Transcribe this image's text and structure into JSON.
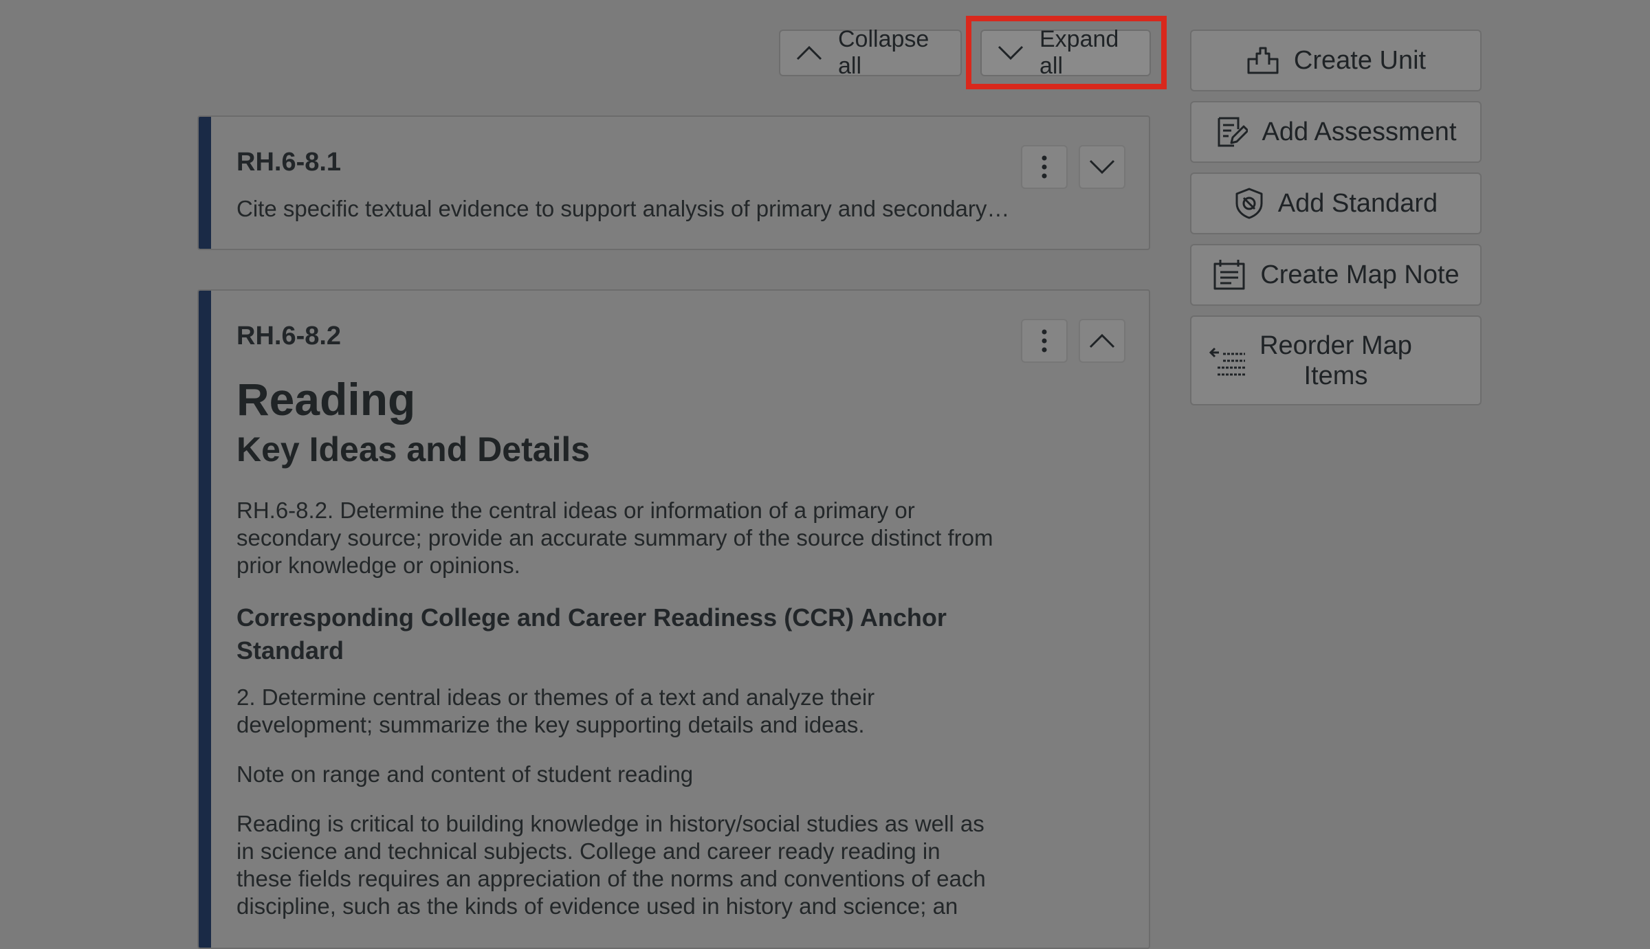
{
  "toolbar": {
    "collapse_all": "Collapse all",
    "expand_all": "Expand all"
  },
  "cards": [
    {
      "code": "RH.6-8.1",
      "summary": "Cite specific textual evidence to support analysis of primary and secondary…",
      "expanded": false
    },
    {
      "code": "RH.6-8.2",
      "expanded": true,
      "heading": "Reading",
      "subheading": "Key Ideas and Details",
      "description": "RH.6-8.2. Determine the central ideas or information of a primary or secondary source; provide an accurate summary of the source distinct from prior knowledge or opinions.",
      "ccr_heading": "Corresponding College and Career Readiness (CCR) Anchor Standard",
      "ccr_text": "2. Determine central ideas or themes of a text and analyze their development; summarize the key supporting details and ideas.",
      "note_title": "Note on range and content of student reading",
      "note_text": "Reading is critical to building knowledge in history/social studies as well as in science and technical subjects. College and career ready reading in these fields requires an appreciation of the norms and conventions of each discipline, such as the kinds of evidence used in history and science; an"
    }
  ],
  "sidebar": {
    "create_unit": "Create Unit",
    "add_assessment": "Add Assessment",
    "add_standard": "Add Standard",
    "create_map_note": "Create Map Note",
    "reorder_map_items": "Reorder Map Items"
  },
  "colors": {
    "accent_bar": "#1a2a46",
    "highlight": "#d9281c"
  }
}
